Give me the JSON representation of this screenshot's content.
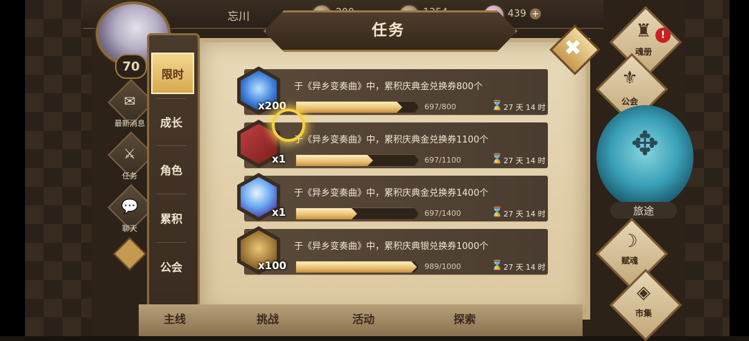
{
  "header": {
    "player_name": "忘川",
    "level": "70",
    "currencies": [
      {
        "icon": "gold-coin-icon",
        "value": "200"
      },
      {
        "icon": "silver-coin-icon",
        "value": "1354"
      },
      {
        "icon": "gem-icon",
        "value": "439"
      }
    ],
    "add_symbol": "+"
  },
  "left_menu": [
    {
      "label": "最新消息",
      "icon": "news-icon"
    },
    {
      "label": "任务",
      "icon": "task-icon"
    },
    {
      "label": "聊天",
      "icon": "chat-icon"
    }
  ],
  "panel": {
    "title": "任务",
    "close_symbol": "✖"
  },
  "tabs": [
    {
      "label": "限时",
      "active": true
    },
    {
      "label": "成长",
      "active": false
    },
    {
      "label": "角色",
      "active": false
    },
    {
      "label": "累积",
      "active": false
    },
    {
      "label": "公会",
      "active": false
    }
  ],
  "tasks": [
    {
      "icon": "blue-crystal-icon",
      "count": "x200",
      "description": "于《异乡变奏曲》中，累积庆典金兑换券800个",
      "progress": "697/800",
      "ratio": 0.87,
      "time_left": "27 天 14 时"
    },
    {
      "icon": "spellbook-icon",
      "count": "x1",
      "description": "于《异乡变奏曲》中，累积庆典金兑换券1100个",
      "progress": "697/1100",
      "ratio": 0.63,
      "time_left": "27 天 14 时"
    },
    {
      "icon": "crystal-orb-icon",
      "count": "x1",
      "description": "于《异乡变奏曲》中，累积庆典金兑换券1400个",
      "progress": "697/1400",
      "ratio": 0.5,
      "time_left": "27 天 14 时"
    },
    {
      "icon": "treasure-relic-icon",
      "count": "x100",
      "description": "于《异乡变奏曲》中，累积庆典银兑换券1000个",
      "progress": "989/1000",
      "ratio": 0.99,
      "time_left": "27 天 14 时"
    }
  ],
  "right_menu": {
    "soul_book": "魂册",
    "guild": "公会",
    "journey": "旅途",
    "fu_hun": "赋魂",
    "market": "市集",
    "alert": "!"
  },
  "bottom_nav": [
    "主线",
    "挑战",
    "活动",
    "探索"
  ],
  "colors": {
    "accent_gold": "#d8a850",
    "panel_parchment": "#e8d9b8",
    "alert_red": "#c82020"
  }
}
